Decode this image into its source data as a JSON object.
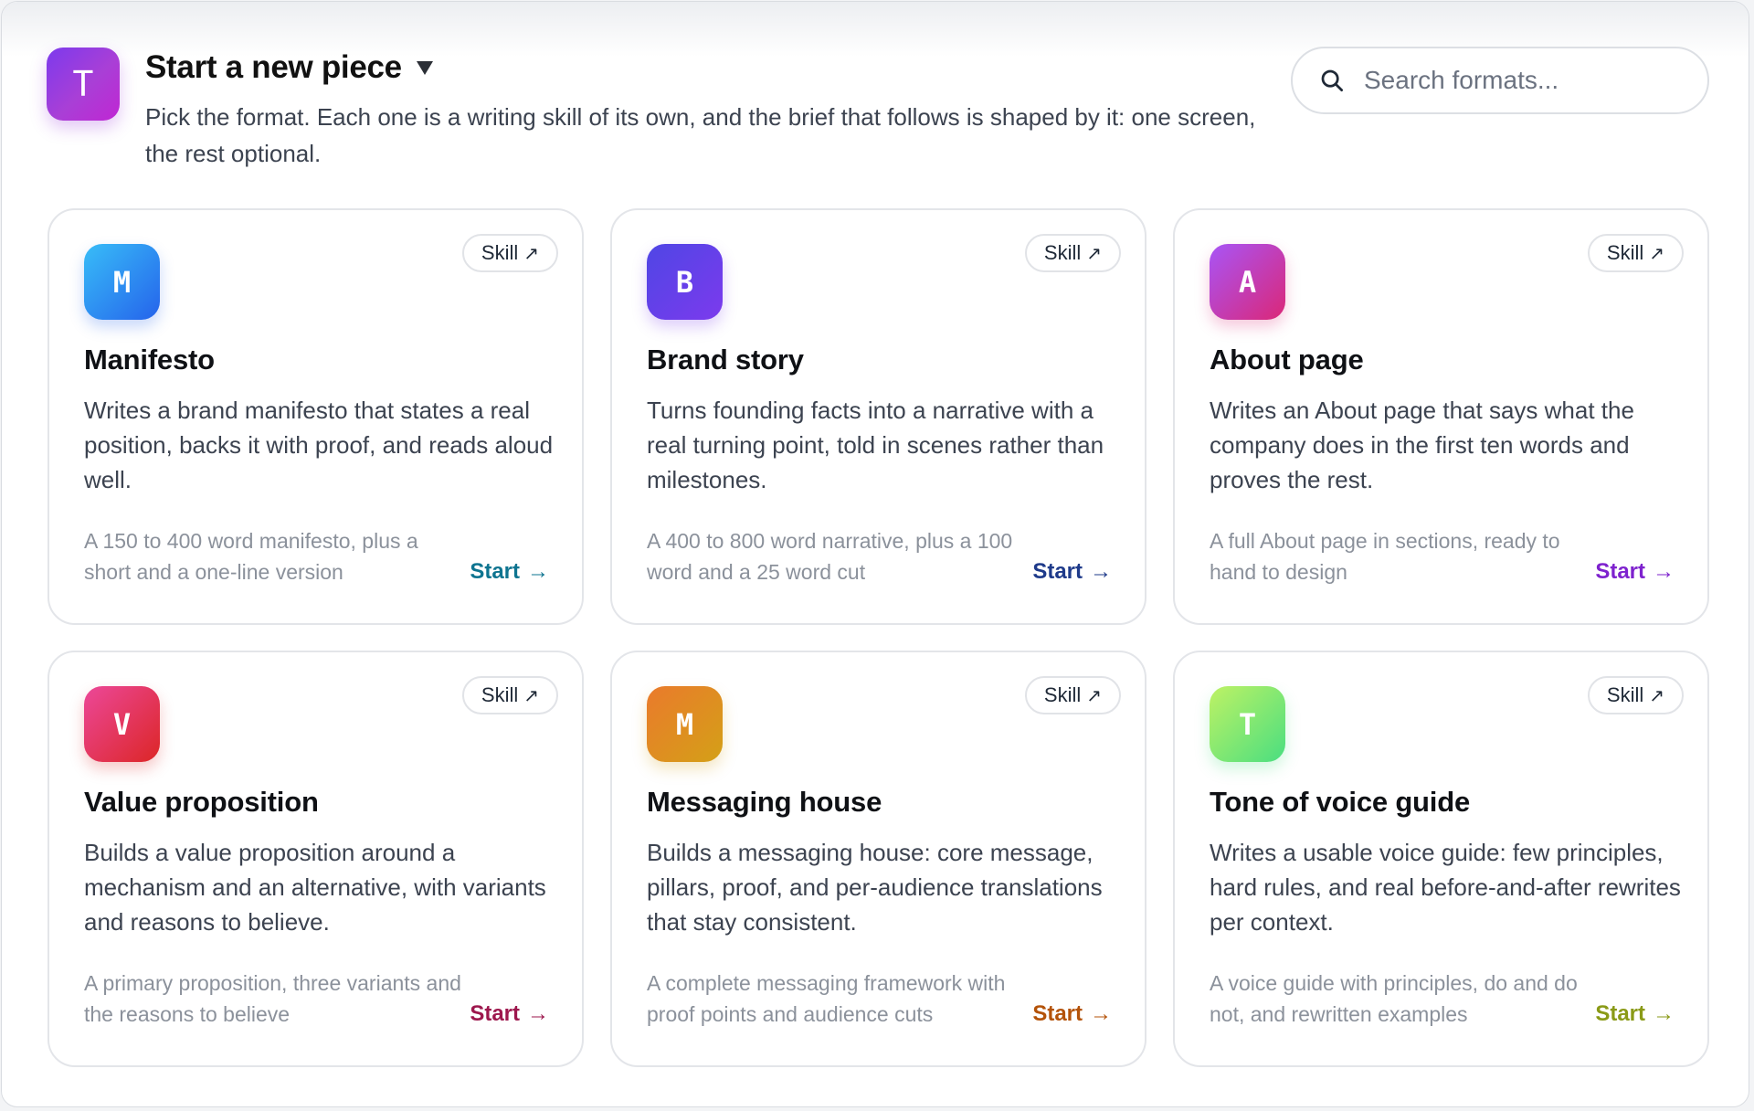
{
  "header": {
    "logo_letter": "T",
    "title": "Start a new piece",
    "subtitle": "Pick the format. Each one is a writing skill of its own, and the brief that follows is shaped by it: one screen, the rest optional."
  },
  "search": {
    "placeholder": "Search formats..."
  },
  "cards": [
    {
      "letter": "M",
      "title": "Manifesto",
      "description": "Writes a brand manifesto that states a real position, backs it with proof, and reads aloud well.",
      "output": "A 150 to 400 word manifesto, plus a short and a one-line version",
      "skill_label": "Skill",
      "start_label": "Start",
      "gradient": [
        "#38bdf8",
        "#2563eb"
      ],
      "accent": "#0e7490"
    },
    {
      "letter": "B",
      "title": "Brand story",
      "description": "Turns founding facts into a narrative with a real turning point, told in scenes rather than milestones.",
      "output": "A 400 to 800 word narrative, plus a 100 word and a 25 word cut",
      "skill_label": "Skill",
      "start_label": "Start",
      "gradient": [
        "#4f46e5",
        "#7c3aed"
      ],
      "accent": "#1e3a8a"
    },
    {
      "letter": "A",
      "title": "About page",
      "description": "Writes an About page that says what the company does in the first ten words and proves the rest.",
      "output": "A full About page in sections, ready to hand to design",
      "skill_label": "Skill",
      "start_label": "Start",
      "gradient": [
        "#a855f7",
        "#db2777"
      ],
      "accent": "#7e22ce"
    },
    {
      "letter": "V",
      "title": "Value proposition",
      "description": "Builds a value proposition around a mechanism and an alternative, with variants and reasons to believe.",
      "output": "A primary proposition, three variants and the reasons to believe",
      "skill_label": "Skill",
      "start_label": "Start",
      "gradient": [
        "#ec4899",
        "#dc2626"
      ],
      "accent": "#9d174d"
    },
    {
      "letter": "M",
      "title": "Messaging house",
      "description": "Builds a messaging house: core message, pillars, proof, and per-audience translations that stay consistent.",
      "output": "A complete messaging framework with proof points and audience cuts",
      "skill_label": "Skill",
      "start_label": "Start",
      "gradient": [
        "#ea7a2c",
        "#d4a017"
      ],
      "accent": "#b45309"
    },
    {
      "letter": "T",
      "title": "Tone of voice guide",
      "description": "Writes a usable voice guide: few principles, hard rules, and real before-and-after rewrites per context.",
      "output": "A voice guide with principles, do and do not, and rewritten examples",
      "skill_label": "Skill",
      "start_label": "Start",
      "gradient": [
        "#bef264",
        "#4ade80"
      ],
      "accent": "#8a9a17"
    }
  ]
}
